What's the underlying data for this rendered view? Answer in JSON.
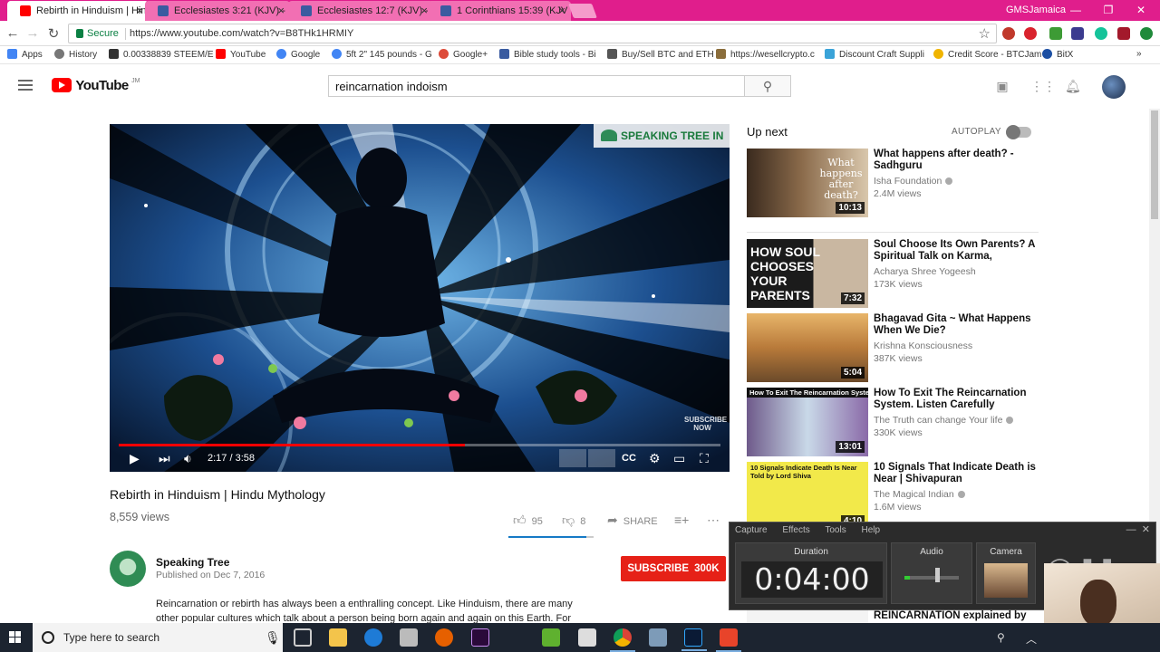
{
  "browser": {
    "tabs": [
      {
        "title": "Rebirth in Hinduism | Hin",
        "active": true,
        "favicon_color": "#ff0000"
      },
      {
        "title": "Ecclesiastes 3:21 (KJV) - ",
        "active": false,
        "favicon_color": "#3a5ba0"
      },
      {
        "title": "Ecclesiastes 12:7 (KJV) - ",
        "active": false,
        "favicon_color": "#3a5ba0"
      },
      {
        "title": "1 Corinthians 15:39 (KJV",
        "active": false,
        "favicon_color": "#3a5ba0"
      }
    ],
    "profile_name": "GMSJamaica",
    "secure_label": "Secure",
    "url": "https://www.youtube.com/watch?v=B8THk1HRMIY",
    "bookmarks": [
      {
        "label": "Apps",
        "icon": "apps-grid-icon",
        "color": "#4285f4"
      },
      {
        "label": "History",
        "icon": "history-icon",
        "color": "#777777"
      },
      {
        "label": "0.00338839 STEEM/E",
        "icon": "steem-icon",
        "color": "#333333"
      },
      {
        "label": "YouTube",
        "icon": "youtube-icon",
        "color": "#ff0000"
      },
      {
        "label": "Google",
        "icon": "google-icon",
        "color": "#4285f4"
      },
      {
        "label": "5ft 2\" 145 pounds - G",
        "icon": "google-icon",
        "color": "#4285f4"
      },
      {
        "label": "Google+",
        "icon": "google-plus-icon",
        "color": "#dd4b39"
      },
      {
        "label": "Bible study tools - Bi",
        "icon": "bible-icon",
        "color": "#3a5ba0"
      },
      {
        "label": "Buy/Sell BTC and ETH",
        "icon": "exchange-icon",
        "color": "#555555"
      },
      {
        "label": "https://wesellcrypto.c",
        "icon": "link-icon",
        "color": "#8a6d3b"
      },
      {
        "label": "Discount Craft Suppli",
        "icon": "craft-icon",
        "color": "#3aa3d8"
      },
      {
        "label": "Credit Score - BTCJam",
        "icon": "credit-icon",
        "color": "#f0b400"
      },
      {
        "label": "BitX",
        "icon": "bitx-icon",
        "color": "#1c4fa3"
      }
    ]
  },
  "youtube": {
    "logo_text": "YouTube",
    "logo_region": "JM",
    "search_query": "reincarnation indoism",
    "video": {
      "title": "Rebirth in Hinduism | Hindu Mythology",
      "views": "8,559 views",
      "current_time": "2:17",
      "total_time": "3:58",
      "time_display": "2:17 / 3:58",
      "progress_fraction": 0.575,
      "overlay_brand": "SPEAKING TREE",
      "overlay_brand_suffix": "IN",
      "overlay_subscribe": "SUBSCRIBE NOW",
      "likes": "95",
      "dislikes": "8",
      "share_label": "SHARE",
      "like_fraction": 0.92
    },
    "channel": {
      "name": "Speaking Tree",
      "published": "Published on Dec 7, 2016",
      "subscribe_label": "SUBSCRIBE",
      "subscriber_count": "300K"
    },
    "description": "Reincarnation or rebirth has always been a enthralling concept. Like Hinduism, there are many other popular cultures which talk about a person being born again and again on this Earth. For",
    "sidebar": {
      "up_next_label": "Up next",
      "autoplay_label": "AUTOPLAY",
      "recommendations": [
        {
          "title": "What happens after death? - Sadhguru",
          "channel": "Isha Foundation",
          "verified": true,
          "views": "2.4M views",
          "duration": "10:13",
          "thumb_caption": "What happens after death?"
        },
        {
          "title": "Soul Choose Its Own Parents? A Spiritual Talk on Karma,",
          "channel": "Acharya Shree Yogeesh",
          "verified": false,
          "views": "173K views",
          "duration": "7:32",
          "thumb_caption": "HOW SOUL CHOOSES YOUR PARENTS"
        },
        {
          "title": "Bhagavad Gita ~ What Happens When We Die?",
          "channel": "Krishna Konsciousness",
          "verified": false,
          "views": "387K views",
          "duration": "5:04",
          "thumb_caption": ""
        },
        {
          "title": "How To Exit The Reincarnation System. Listen Carefully",
          "channel": "The Truth can change Your life",
          "verified": true,
          "views": "330K views",
          "duration": "13:01",
          "thumb_caption": "How To Exit The Reincarnation System"
        },
        {
          "title": "10 Signals That Indicate Death is Near | Shivapuran",
          "channel": "The Magical Indian",
          "verified": true,
          "views": "1.6M views",
          "duration": "4:10",
          "thumb_caption": "10 Signals Indicate Death Is Near Told by Lord Shiva"
        },
        {
          "title": "REINCARNATION explained by",
          "channel": "",
          "verified": false,
          "views": "",
          "duration": "",
          "thumb_caption": ""
        }
      ]
    }
  },
  "recorder": {
    "menu": [
      "Capture",
      "Effects",
      "Tools",
      "Help"
    ],
    "duration_label": "Duration",
    "duration_value": "0:04:00",
    "audio_label": "Audio",
    "camera_label": "Camera"
  },
  "taskbar": {
    "search_placeholder": "Type here to search",
    "apps": [
      "task-view",
      "file-explorer",
      "edge",
      "mail",
      "firefox",
      "premiere",
      "utorrent",
      "movies",
      "chrome",
      "settings",
      "photoshop",
      "camtasia"
    ]
  },
  "colors": {
    "chrome_frame": "#e01e8c",
    "youtube_red": "#ff0000",
    "subscribe_red": "#e62117",
    "link_blue": "#167ac6"
  }
}
